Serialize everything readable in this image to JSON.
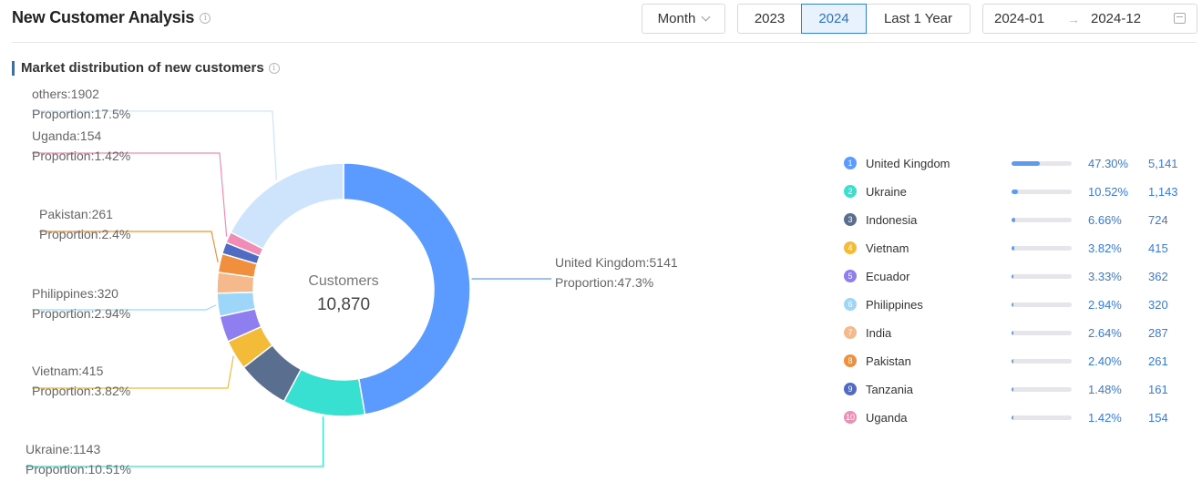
{
  "header": {
    "title": "New Customer Analysis",
    "period_select": "Month",
    "year_tabs": [
      "2023",
      "2024",
      "Last 1 Year"
    ],
    "selected_year": "2024",
    "date_start": "2024-01",
    "date_end": "2024-12",
    "range_separator": "→"
  },
  "section_title": "Market distribution of new customers",
  "info_glyph": "i",
  "chart_data": {
    "type": "donut",
    "center_label": "Customers",
    "center_value": "10,870",
    "slices": [
      {
        "name": "United Kingdom",
        "value": 5141,
        "color": "#5b9bff"
      },
      {
        "name": "Ukraine",
        "value": 1143,
        "color": "#38e0d2"
      },
      {
        "name": "Indonesia",
        "value": 724,
        "color": "#5a6f8f"
      },
      {
        "name": "Vietnam",
        "value": 415,
        "color": "#f3bb38"
      },
      {
        "name": "Ecuador",
        "value": 362,
        "color": "#8f7ef0"
      },
      {
        "name": "Philippines",
        "value": 320,
        "color": "#9ed6fa"
      },
      {
        "name": "India",
        "value": 287,
        "color": "#f5b98c"
      },
      {
        "name": "Pakistan",
        "value": 261,
        "color": "#f0903e"
      },
      {
        "name": "Tanzania",
        "value": 161,
        "color": "#4f6bc4"
      },
      {
        "name": "Uganda",
        "value": 154,
        "color": "#f08cb5"
      },
      {
        "name": "others",
        "value": 1902,
        "color": "#cde4fc"
      }
    ],
    "callouts": [
      {
        "slice": 0,
        "name": "United Kingdom:5141",
        "proportion": "Proportion:47.3%"
      },
      {
        "slice": 1,
        "name": "Ukraine:1143",
        "proportion": "Proportion:10.51%"
      },
      {
        "slice": 3,
        "name": "Vietnam:415",
        "proportion": "Proportion:3.82%"
      },
      {
        "slice": 5,
        "name": "Philippines:320",
        "proportion": "Proportion:2.94%"
      },
      {
        "slice": 7,
        "name": "Pakistan:261",
        "proportion": "Proportion:2.4%"
      },
      {
        "slice": 9,
        "name": "Uganda:154",
        "proportion": "Proportion:1.42%"
      },
      {
        "slice": 10,
        "name": "others:1902",
        "proportion": "Proportion:17.5%"
      }
    ]
  },
  "legend": [
    {
      "rank": "1",
      "name": "United Kingdom",
      "pct": "47.30%",
      "value": "5,141",
      "share": 0.473,
      "color": "#5b9bff"
    },
    {
      "rank": "2",
      "name": "Ukraine",
      "pct": "10.52%",
      "value": "1,143",
      "share": 0.1052,
      "color": "#38e0d2"
    },
    {
      "rank": "3",
      "name": "Indonesia",
      "pct": "6.66%",
      "value": "724",
      "share": 0.0666,
      "color": "#5a6f8f"
    },
    {
      "rank": "4",
      "name": "Vietnam",
      "pct": "3.82%",
      "value": "415",
      "share": 0.0382,
      "color": "#f3bb38"
    },
    {
      "rank": "5",
      "name": "Ecuador",
      "pct": "3.33%",
      "value": "362",
      "share": 0.0333,
      "color": "#8f7ef0"
    },
    {
      "rank": "6",
      "name": "Philippines",
      "pct": "2.94%",
      "value": "320",
      "share": 0.0294,
      "color": "#9ed6fa"
    },
    {
      "rank": "7",
      "name": "India",
      "pct": "2.64%",
      "value": "287",
      "share": 0.0264,
      "color": "#f5b98c"
    },
    {
      "rank": "8",
      "name": "Pakistan",
      "pct": "2.40%",
      "value": "261",
      "share": 0.024,
      "color": "#f0903e"
    },
    {
      "rank": "9",
      "name": "Tanzania",
      "pct": "1.48%",
      "value": "161",
      "share": 0.0148,
      "color": "#4f6bc4"
    },
    {
      "rank": "10",
      "name": "Uganda",
      "pct": "1.42%",
      "value": "154",
      "share": 0.0142,
      "color": "#f08cb5"
    }
  ]
}
